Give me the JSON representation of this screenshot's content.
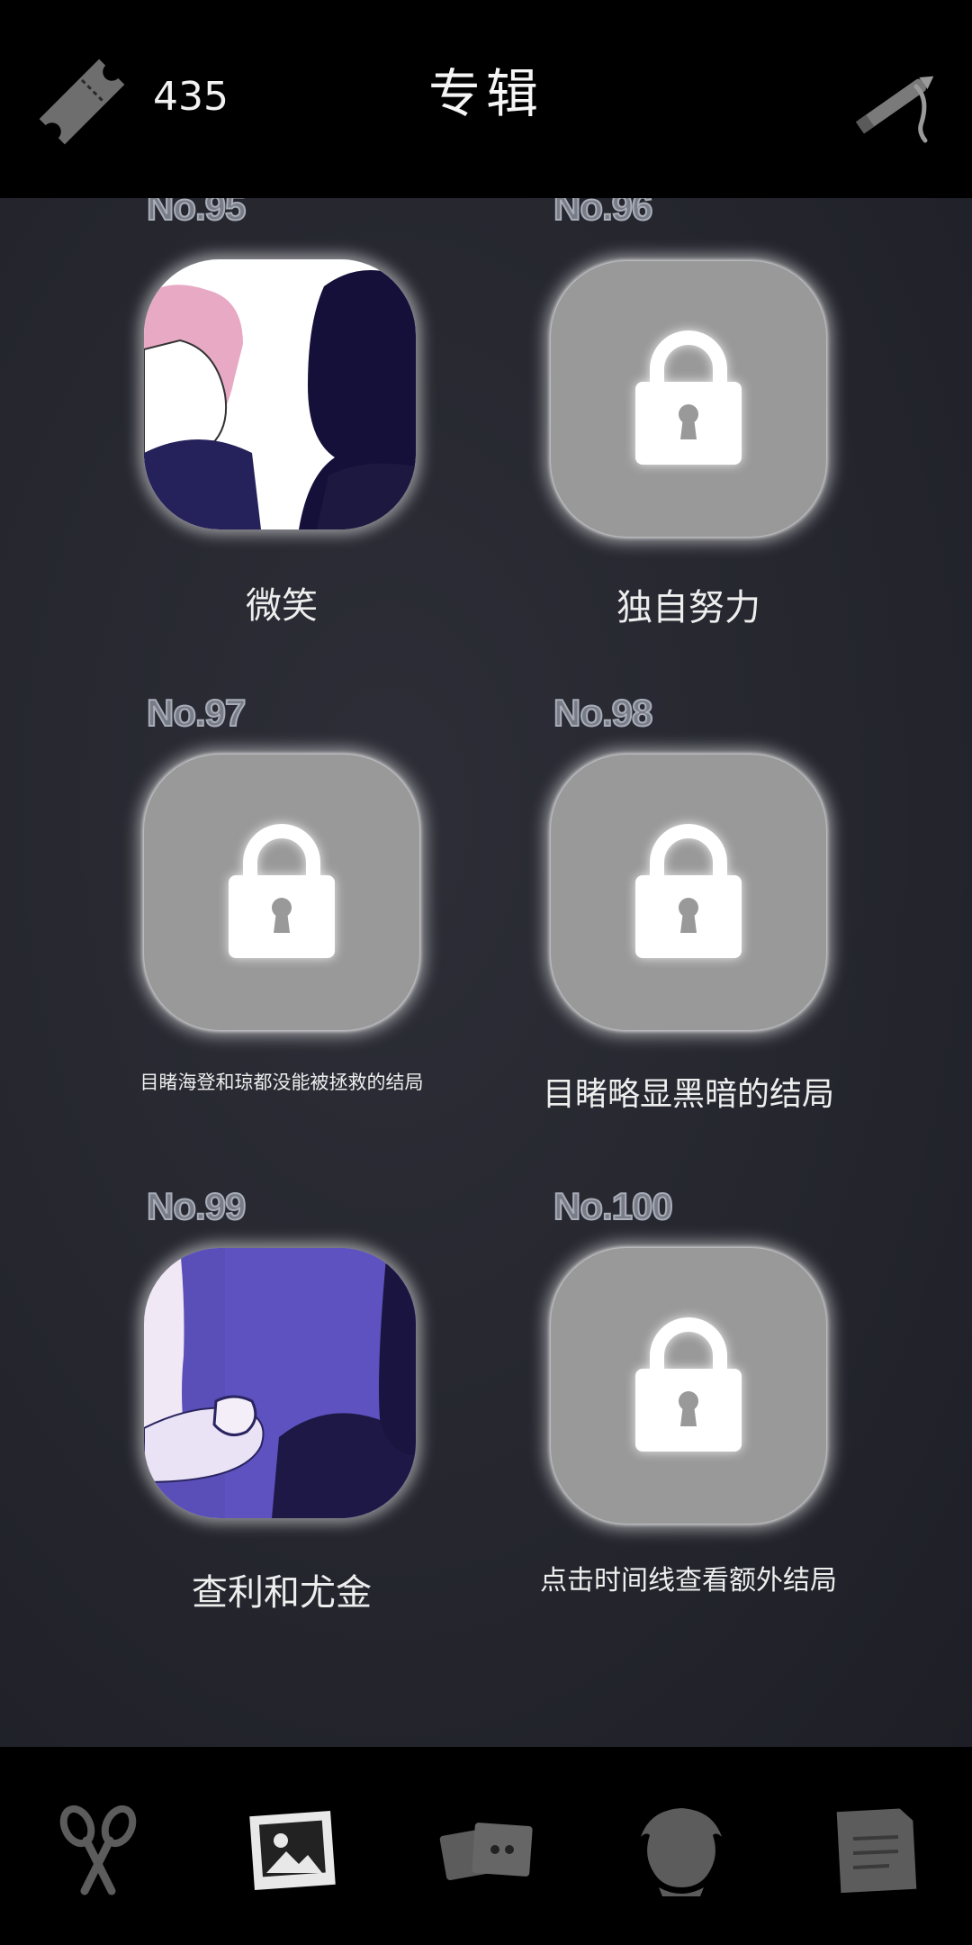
{
  "header": {
    "ticket_count": "435",
    "title": "专辑"
  },
  "albums": [
    {
      "number": "No.95",
      "caption": "微笑",
      "locked": false
    },
    {
      "number": "No.96",
      "caption": "独自努力",
      "locked": true
    },
    {
      "number": "No.97",
      "caption": "目睹海登和琼都没能被拯救的结局",
      "locked": true
    },
    {
      "number": "No.98",
      "caption": "目睹略显黑暗的结局",
      "locked": true
    },
    {
      "number": "No.99",
      "caption": "查利和尤金",
      "locked": false
    },
    {
      "number": "No.100",
      "caption": "点击时间线查看额外结局",
      "locked": true
    }
  ],
  "icons": {
    "ticket": "ticket-icon",
    "pen": "pen-icon",
    "lock": "lock-icon",
    "nav": [
      "scissors-icon",
      "album-icon",
      "cards-icon",
      "character-icon",
      "notes-icon"
    ]
  },
  "nav": {
    "active_index": 1
  },
  "colors": {
    "background": "#25262e",
    "locked_tile": "#999999",
    "number_label": "#777c87",
    "caption_text": "#eeeeee"
  }
}
